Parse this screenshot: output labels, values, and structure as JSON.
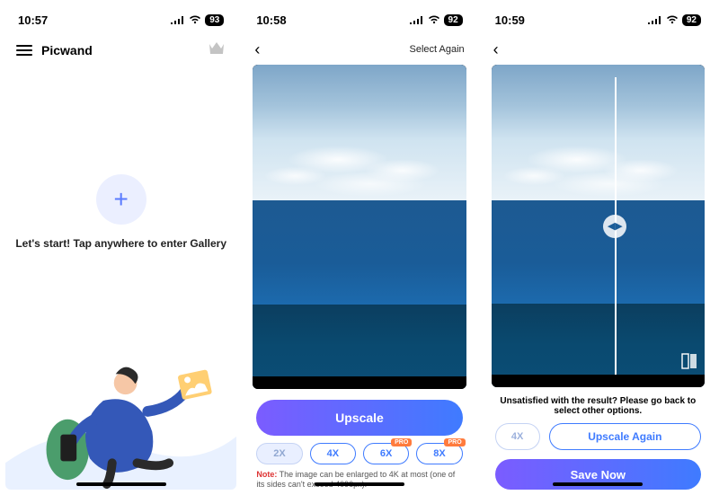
{
  "screen1": {
    "status": {
      "time": "10:57",
      "battery": "93"
    },
    "app_title": "Picwand",
    "tagline": "Let's start! Tap anywhere to enter Gallery"
  },
  "screen2": {
    "status": {
      "time": "10:58",
      "battery": "92"
    },
    "nav_action": "Select Again",
    "primary_button": "Upscale",
    "scales": [
      {
        "label": "2X",
        "selected": true,
        "pro": false
      },
      {
        "label": "4X",
        "selected": false,
        "pro": false
      },
      {
        "label": "6X",
        "selected": false,
        "pro": true
      },
      {
        "label": "8X",
        "selected": false,
        "pro": true
      }
    ],
    "pro_tag": "PRO",
    "note_label": "Note:",
    "note_text": " The image can be enlarged to 4K at most (one of its sides can't exceed 4096px)."
  },
  "screen3": {
    "status": {
      "time": "10:59",
      "battery": "92"
    },
    "message": "Unsatisfied with the result? Please go back to select other options.",
    "current_scale": "4X",
    "upscale_again": "Upscale Again",
    "save": "Save Now"
  }
}
